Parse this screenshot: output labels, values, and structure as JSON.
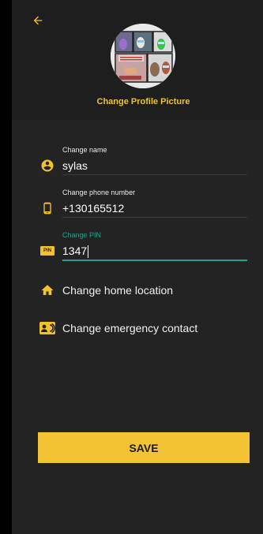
{
  "header": {
    "change_picture_label": "Change Profile Picture"
  },
  "form": {
    "name": {
      "label": "Change name",
      "value": "sylas"
    },
    "phone": {
      "label": "Change phone number",
      "value": "+130165512"
    },
    "pin": {
      "label": "Change PIN",
      "value": "1347",
      "badge": "PIN"
    }
  },
  "actions": {
    "home_location": "Change home location",
    "emergency_contact": "Change emergency contact"
  },
  "save_label": "SAVE",
  "colors": {
    "accent": "#f4c333",
    "focus": "#1aa58f",
    "background": "#232323"
  },
  "icons": {
    "back": "arrow-left-icon",
    "name": "account-circle-icon",
    "phone": "smartphone-icon",
    "pin": "pin-badge-icon",
    "home": "home-icon",
    "emergency": "contact-card-icon"
  }
}
